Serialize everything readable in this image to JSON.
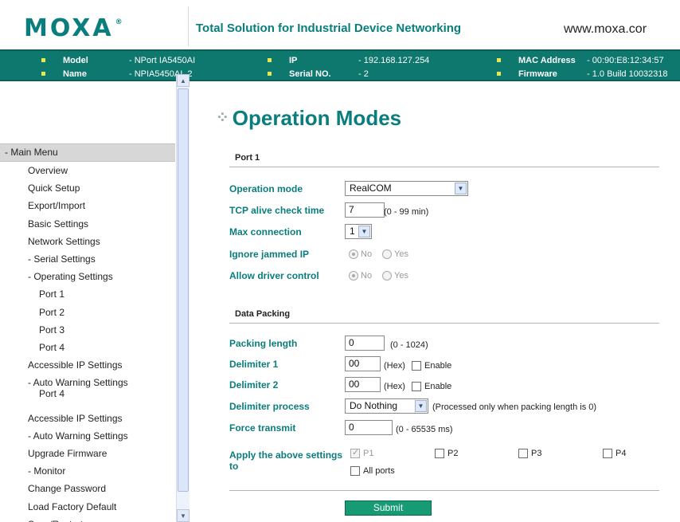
{
  "header": {
    "logo": "MOXA",
    "logo_mark": "®",
    "tagline": "Total Solution for Industrial Device Networking",
    "website": "www.moxa.cor"
  },
  "info": {
    "model_label": "Model",
    "model_value": "- NPort IA5450AI",
    "name_label": "Name",
    "name_value": "- NPIA5450AI_2",
    "ip_label": "IP",
    "ip_value": "- 192.168.127.254",
    "serial_label": "Serial NO.",
    "serial_value": "- 2",
    "mac_label": "MAC Address",
    "mac_value": "- 00:90:E8:12:34:57",
    "firmware_label": "Firmware",
    "firmware_value": "- 1.0 Build 10032318"
  },
  "sidebar": {
    "menu_header": "- Main Menu",
    "items": [
      "Overview",
      "Quick Setup",
      "Export/Import",
      "Basic Settings",
      "Network Settings",
      "- Serial Settings",
      "- Operating Settings",
      "Port 1",
      "Port 2",
      "Port 3",
      "Port 4",
      "Accessible IP Settings",
      "- Auto Warning Settings",
      "Port 4",
      "Accessible IP Settings",
      "- Auto Warning Settings",
      "Upgrade Firmware",
      "- Monitor",
      "Change Password",
      "Load Factory Default",
      "Save/Restart"
    ]
  },
  "main": {
    "title": "Operation Modes",
    "port_section": "Port 1",
    "operation_mode_label": "Operation mode",
    "operation_mode_value": "RealCOM",
    "tcp_alive_label": "TCP alive check time",
    "tcp_alive_value": "7",
    "tcp_alive_hint": "(0 - 99 min)",
    "max_connection_label": "Max connection",
    "max_connection_value": "1",
    "ignore_jammed_label": "Ignore jammed IP",
    "allow_driver_label": "Allow driver control",
    "radio_no": "No",
    "radio_yes": "Yes",
    "data_packing_section": "Data Packing",
    "packing_length_label": "Packing length",
    "packing_length_value": "0",
    "packing_length_hint": "(0 - 1024)",
    "delimiter1_label": "Delimiter 1",
    "delimiter1_value": "00",
    "delimiter2_label": "Delimiter 2",
    "delimiter2_value": "00",
    "hex_hint": "(Hex)",
    "enable_label": "Enable",
    "delimiter_process_label": "Delimiter process",
    "delimiter_process_value": "Do Nothing",
    "delimiter_process_hint": "(Processed only when packing length is 0)",
    "force_transmit_label": "Force transmit",
    "force_transmit_value": "0",
    "force_transmit_hint": "(0 - 65535 ms)",
    "apply_label_line1": "Apply the above settings",
    "apply_label_line2": "to",
    "p1": "P1",
    "p2": "P2",
    "p3": "P3",
    "p4": "P4",
    "all_ports": "All ports",
    "submit": "Submit"
  },
  "colors": {
    "brand_teal": "#0a7d7d",
    "infobar_bg": "#0e776e",
    "submit_bg": "#169b75"
  }
}
